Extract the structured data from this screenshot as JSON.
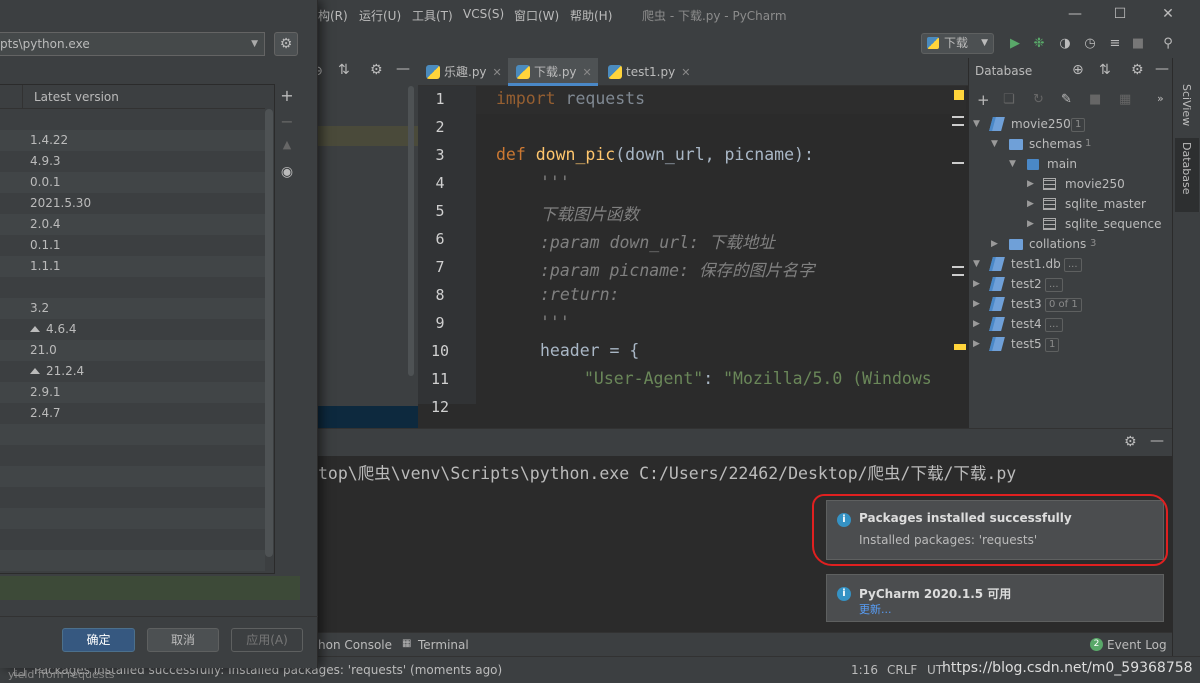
{
  "window": {
    "title": "爬虫 - 下载.py - PyCharm",
    "menu": [
      "构(R)",
      "运行(U)",
      "工具(T)",
      "VCS(S)",
      "窗口(W)",
      "帮助(H)"
    ]
  },
  "toolbar": {
    "run_config": "下载"
  },
  "editor": {
    "tabs": [
      {
        "label": "乐趣.py"
      },
      {
        "label": "下载.py"
      },
      {
        "label": "test1.py"
      }
    ],
    "line_numbers": [
      "1",
      "2",
      "3",
      "4",
      "5",
      "6",
      "7",
      "8",
      "9",
      "10",
      "11",
      "12"
    ],
    "lines": {
      "l1_kw": "import",
      "l1_rest": " requests",
      "l3_kw": "def",
      "l3_fn": " down_pic",
      "l3_rest": "(down_url, picname):",
      "l4": "'''",
      "l5": "下载图片函数",
      "l6": ":param down_url: 下载地址",
      "l7": ":param picname: 保存的图片名字",
      "l8": ":return:",
      "l9": "'''",
      "l10": "header = {",
      "l11_key": "\"User-Agent\"",
      "l11_sep": ": ",
      "l11_val": "\"Mozilla/5.0 (Windows"
    }
  },
  "database_panel": {
    "title": "Database",
    "tree": [
      {
        "label": "movie250",
        "badge": "1"
      },
      {
        "label": "schemas",
        "badge": "1"
      },
      {
        "label": "main"
      },
      {
        "label": "movie250"
      },
      {
        "label": "sqlite_master"
      },
      {
        "label": "sqlite_sequence"
      },
      {
        "label": "collations",
        "badge": "3"
      },
      {
        "label": "test1.db",
        "badge": "..."
      },
      {
        "label": "test2",
        "badge": "..."
      },
      {
        "label": "test3",
        "badge": "0 of 1"
      },
      {
        "label": "test4",
        "badge": "..."
      },
      {
        "label": "test5",
        "badge": "1"
      }
    ]
  },
  "side_tabs": {
    "sciview": "SciView",
    "database": "Database"
  },
  "console": {
    "command": "top\\爬虫\\venv\\Scripts\\python.exe C:/Users/22462/Desktop/爬虫/下载/下载.py"
  },
  "notifications": [
    {
      "title": "Packages installed successfully",
      "body": "Installed packages: 'requests'"
    },
    {
      "title": "PyCharm 2020.1.5 可用",
      "body": "更新..."
    }
  ],
  "tool_tabs": {
    "python_console": "hon Console",
    "terminal": "Terminal",
    "event_log": "Event Log",
    "event_log_count": "2"
  },
  "statusbar": {
    "message": "Packages installed successfully: Installed packages: 'requests' (moments ago)",
    "position": "1:16",
    "line_sep": "CRLF",
    "encoding": "UT",
    "watermark": "https://blog.csdn.net/m0_59368758"
  },
  "dialog": {
    "interpreter": "pts\\python.exe",
    "column_latest": "Latest version",
    "versions": [
      {
        "v": "",
        "up": false
      },
      {
        "v": "1.4.22",
        "up": false
      },
      {
        "v": "4.9.3",
        "up": false
      },
      {
        "v": "0.0.1",
        "up": false
      },
      {
        "v": "2021.5.30",
        "up": false
      },
      {
        "v": "2.0.4",
        "up": false
      },
      {
        "v": "0.1.1",
        "up": false
      },
      {
        "v": "1.1.1",
        "up": false
      },
      {
        "v": "",
        "up": false
      },
      {
        "v": "3.2",
        "up": false
      },
      {
        "v": "4.6.4",
        "up": true
      },
      {
        "v": "21.0",
        "up": false
      },
      {
        "v": "21.2.4",
        "up": true
      },
      {
        "v": "2.9.1",
        "up": false
      },
      {
        "v": "2.4.7",
        "up": false
      }
    ],
    "ok": "确定",
    "cancel": "取消",
    "apply": "应用(A)",
    "bottom_text": "yield from requests"
  }
}
